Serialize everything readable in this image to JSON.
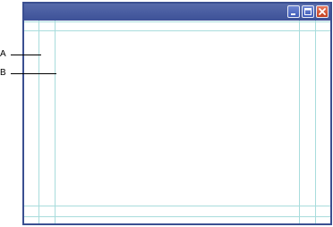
{
  "labels": {
    "a": "A",
    "b": "B"
  },
  "icons": {
    "minimize": "minimize-icon",
    "maximize": "maximize-icon",
    "close": "close-icon"
  },
  "colors": {
    "titlebar": "#3d5198",
    "frame": "#3a4f91",
    "guide": "#a8dcdc",
    "close_button": "#c2401f"
  }
}
